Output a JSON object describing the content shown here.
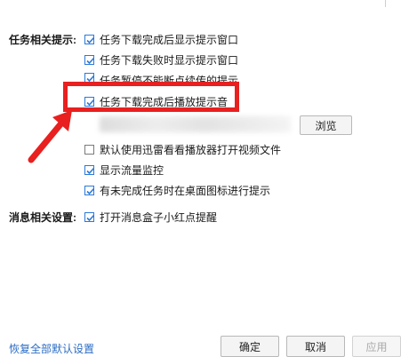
{
  "task_section": {
    "label": "任务相关提示:",
    "items": [
      {
        "label": "任务下载完成后显示提示窗口",
        "checked": true
      },
      {
        "label": "任务下载失败时显示提示窗口",
        "checked": true
      },
      {
        "label": "任务暂停不能断点续传的提示",
        "checked": true
      },
      {
        "label": "任务下载完成后播放提示音",
        "checked": true
      }
    ],
    "browse_label": "浏览",
    "options": [
      {
        "label": "默认使用迅雷看看播放器打开视频文件",
        "checked": false
      },
      {
        "label": "显示流量监控",
        "checked": true
      },
      {
        "label": "有未完成任务时在桌面图标进行提示",
        "checked": true
      }
    ]
  },
  "message_section": {
    "label": "消息相关设置:",
    "items": [
      {
        "label": "打开消息盒子小红点提醒",
        "checked": true
      }
    ]
  },
  "footer": {
    "restore_defaults": "恢复全部默认设置",
    "ok": "确定",
    "cancel": "取消",
    "apply": "应用"
  },
  "colors": {
    "highlight": "#e8201f",
    "check": "#2b79d8",
    "link": "#2b6cc4"
  }
}
